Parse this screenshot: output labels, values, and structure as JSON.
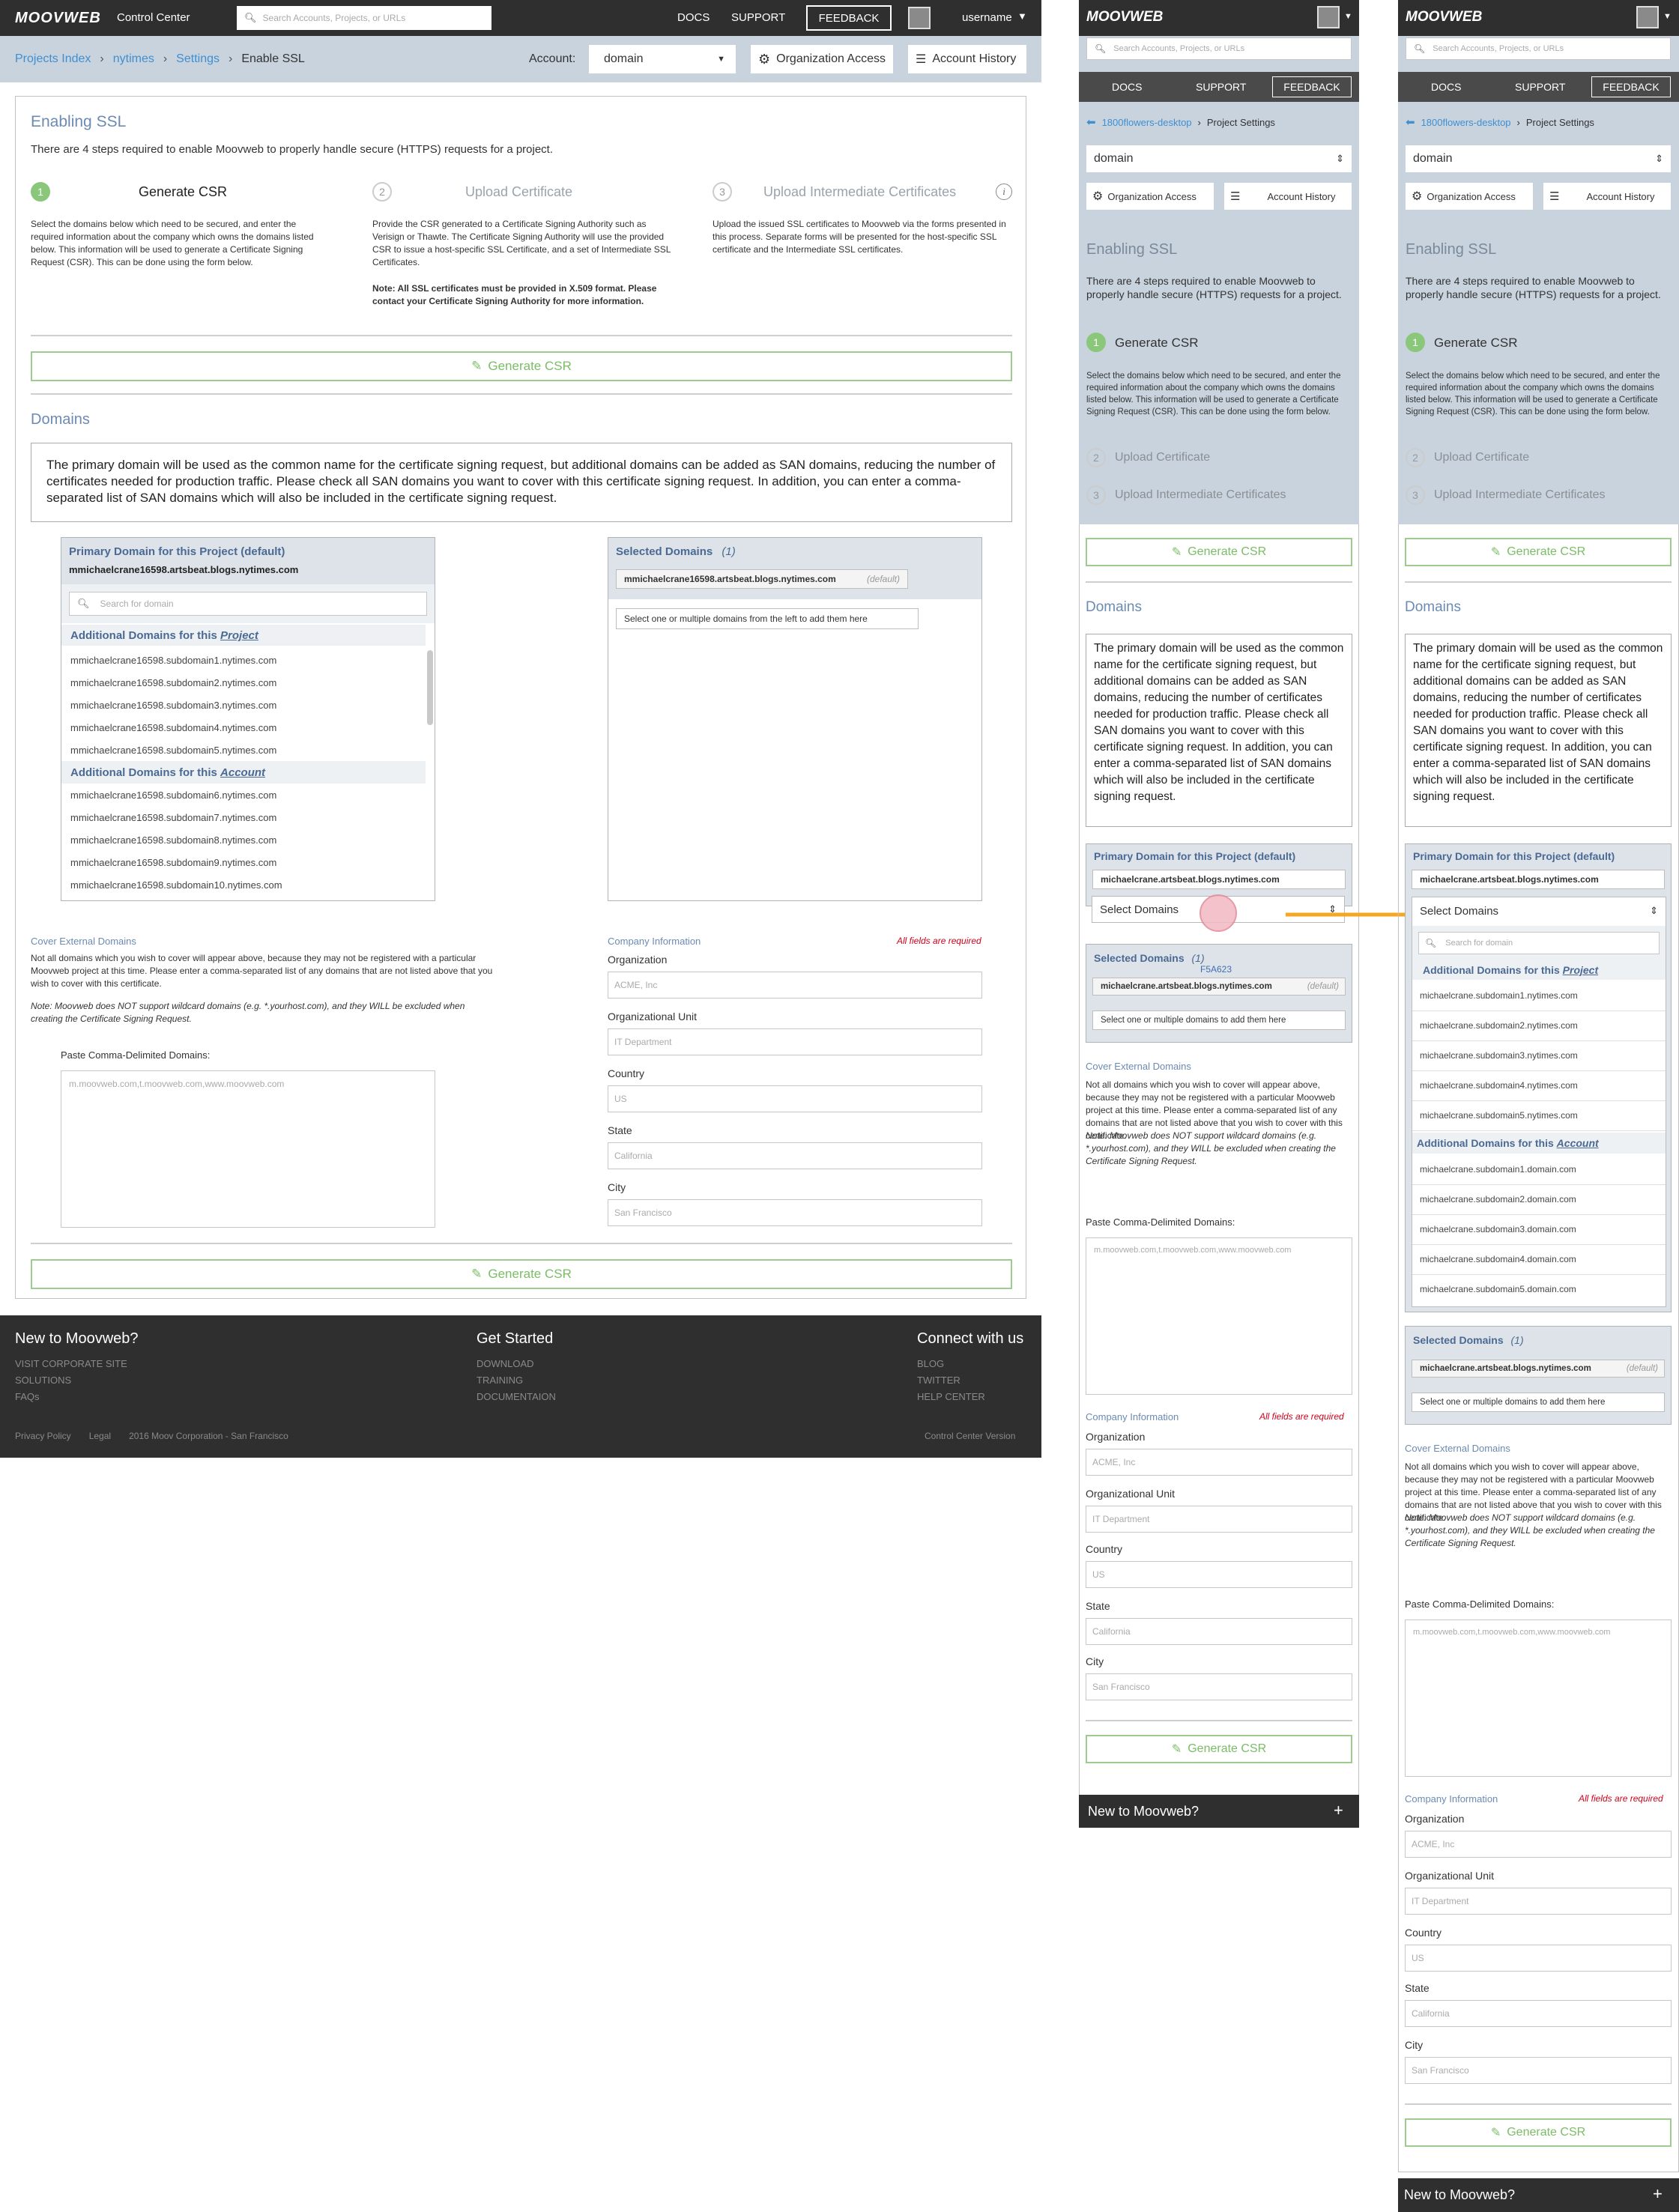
{
  "header": {
    "logo": "MOOVWEB",
    "app_name": "Control Center",
    "search_placeholder": "Search Accounts, Projects, or URLs",
    "nav": [
      "DOCS",
      "SUPPORT"
    ],
    "feedback": "FEEDBACK",
    "username": "username"
  },
  "breadcrumb": {
    "items": [
      "Projects Index",
      "nytimes",
      "Settings"
    ],
    "current": "Enable SSL"
  },
  "account": {
    "label": "Account:",
    "value": "domain",
    "org_access": "Organization Access",
    "history": "Account History"
  },
  "ssl": {
    "title": "Enabling SSL",
    "intro": "There are 4 steps required to enable Moovweb to properly handle secure (HTTPS) requests for a project.",
    "steps": [
      {
        "num": "1",
        "title": "Generate CSR",
        "desc": "Select the domains below which need to be secured, and enter the required information about the company which owns the domains listed below. This information will be used to generate a Certificate Signing Request (CSR). This can be done using the form below."
      },
      {
        "num": "2",
        "title": "Upload Certificate",
        "desc": "Provide the CSR generated to a Certificate Signing Authority such as Verisign or Thawte. The Certificate Signing Authority will use the provided CSR to issue a host-specific SSL Certificate, and a set of Intermediate SSL Certificates.",
        "note": "Note: All SSL certificates must be provided in X.509 format. Please contact your Certificate Signing Authority for more information."
      },
      {
        "num": "3",
        "title": "Upload Intermediate Certificates",
        "desc": "Upload the issued SSL certificates to Moovweb via the forms presented in this process. Separate forms will be presented for the host-specific SSL certificate and the Intermediate SSL certificates."
      }
    ],
    "generate_csr": "Generate CSR"
  },
  "domains": {
    "title": "Domains",
    "info": "The primary domain will be used as the common name for the certificate signing request, but additional domains can be added as SAN domains, reducing the number of certificates needed for production traffic. Please check all SAN domains you want to cover with this certificate signing request. In addition, you can enter a comma-separated list of SAN domains which will also be included in the certificate signing request.",
    "info_mobile": "The primary domain will be used as the common name for the certificate signing request, but additional domains can be added as SAN domains, reducing the number of certificates needed for production traffic. Please check all SAN domains you want to cover with this certificate signing request. In addition, you can enter a comma-separated list of SAN domains which will also be included in the certificate signing request.",
    "primary_title": "Primary Domain for this Project (default)",
    "primary_value": "mmichaelcrane16598.artsbeat.blogs.nytimes.com",
    "search_placeholder": "Search for domain",
    "project_group_prefix": "Additional Domains for this ",
    "project_group_em": "Project",
    "account_group_prefix": "Additional Domains for this ",
    "account_group_em": "Account",
    "project_domains": [
      "mmichaelcrane16598.subdomain1.nytimes.com",
      "mmichaelcrane16598.subdomain2.nytimes.com",
      "mmichaelcrane16598.subdomain3.nytimes.com",
      "mmichaelcrane16598.subdomain4.nytimes.com",
      "mmichaelcrane16598.subdomain5.nytimes.com"
    ],
    "account_domains": [
      "mmichaelcrane16598.subdomain6.nytimes.com",
      "mmichaelcrane16598.subdomain7.nytimes.com",
      "mmichaelcrane16598.subdomain8.nytimes.com",
      "mmichaelcrane16598.subdomain9.nytimes.com",
      "mmichaelcrane16598.subdomain10.nytimes.com"
    ],
    "selected_title": "Selected Domains",
    "selected_count": "(1)",
    "selected_value": "mmichaelcrane16598.artsbeat.blogs.nytimes.com",
    "default_tag": "(default)",
    "select_hint": "Select one or multiple domains from the left to add them here",
    "select_hint_short": "Select one or multiple domains to add them here"
  },
  "external": {
    "title": "Cover External Domains",
    "text": "Not all domains which you wish to cover will appear above, because they may not be registered with a particular Moovweb project at this time. Please enter a comma-separated list of any domains that are not listed above that you wish to cover with this certificate.",
    "note": "Note: Moovweb does NOT support wildcard domains (e.g. *.yourhost.com), and they WILL be excluded when creating the Certificate Signing Request.",
    "paste_label": "Paste Comma-Delimited Domains:",
    "paste_placeholder": "m.moovweb.com,t.moovweb.com,www.moovweb.com"
  },
  "company": {
    "title": "Company Information",
    "required": "All fields are required",
    "fields": [
      {
        "label": "Organization",
        "placeholder": "ACME, Inc"
      },
      {
        "label": "Organizational Unit",
        "placeholder": "IT Department"
      },
      {
        "label": "Country",
        "placeholder": "US"
      },
      {
        "label": "State",
        "placeholder": "California"
      },
      {
        "label": "City",
        "placeholder": "San Francisco"
      }
    ]
  },
  "footer": {
    "col1_title": "New to Moovweb?",
    "col1_links": [
      "VISIT CORPORATE SITE",
      "SOLUTIONS",
      "FAQs"
    ],
    "col2_title": "Get Started",
    "col2_links": [
      "DOWNLOAD",
      "TRAINING",
      "DOCUMENTAION"
    ],
    "col3_title": "Connect with us",
    "col3_links": [
      "BLOG",
      "TWITTER",
      "HELP CENTER"
    ],
    "legal": [
      "Privacy Policy",
      "Legal",
      "2016 Moov Corporation - San Francisco"
    ],
    "version": "Control Center Version",
    "mobile_bar": "New to Moovweb?",
    "mobile_plus": "+"
  },
  "mobile": {
    "back_link": "1800flowers-desktop",
    "crumb_current": "Project Settings",
    "primary_value": "michaelcrane.artsbeat.blogs.nytimes.com",
    "select_domains": "Select Domains",
    "annotation": "F5A623",
    "project_domains": [
      "michaelcrane.subdomain1.nytimes.com",
      "michaelcrane.subdomain2.nytimes.com",
      "michaelcrane.subdomain3.nytimes.com",
      "michaelcrane.subdomain4.nytimes.com",
      "michaelcrane.subdomain5.nytimes.com"
    ],
    "account_domains": [
      "michaelcrane.subdomain1.domain.com",
      "michaelcrane.subdomain2.domain.com",
      "michaelcrane.subdomain3.domain.com",
      "michaelcrane.subdomain4.domain.com",
      "michaelcrane.subdomain5.domain.com"
    ]
  },
  "colors": {
    "header_bg": "#2f2f2f",
    "crumb_bg": "#c8d3dd",
    "accent_green": "#5fb14a",
    "link_blue": "#3f8fd1",
    "required_red": "#d0021b",
    "arrow_orange": "#f5a623"
  }
}
